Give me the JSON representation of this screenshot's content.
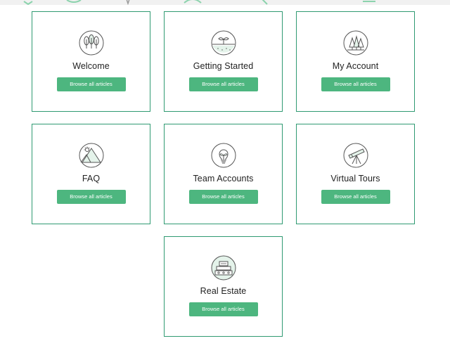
{
  "cards": [
    {
      "title": "Welcome",
      "button": "Browse all articles",
      "icon": "trees-icon"
    },
    {
      "title": "Getting Started",
      "button": "Browse all articles",
      "icon": "sprout-icon"
    },
    {
      "title": "My Account",
      "button": "Browse all articles",
      "icon": "forest-icon"
    },
    {
      "title": "FAQ",
      "button": "Browse all articles",
      "icon": "mountain-icon"
    },
    {
      "title": "Team Accounts",
      "button": "Browse all articles",
      "icon": "lightbulb-plant-icon"
    },
    {
      "title": "Virtual Tours",
      "button": "Browse all articles",
      "icon": "telescope-icon"
    },
    {
      "title": "Real Estate",
      "button": "Browse all articles",
      "icon": "house-icon"
    }
  ],
  "colors": {
    "accent": "#4db67f",
    "border": "#2f9a72",
    "icon_stroke": "#555555"
  }
}
